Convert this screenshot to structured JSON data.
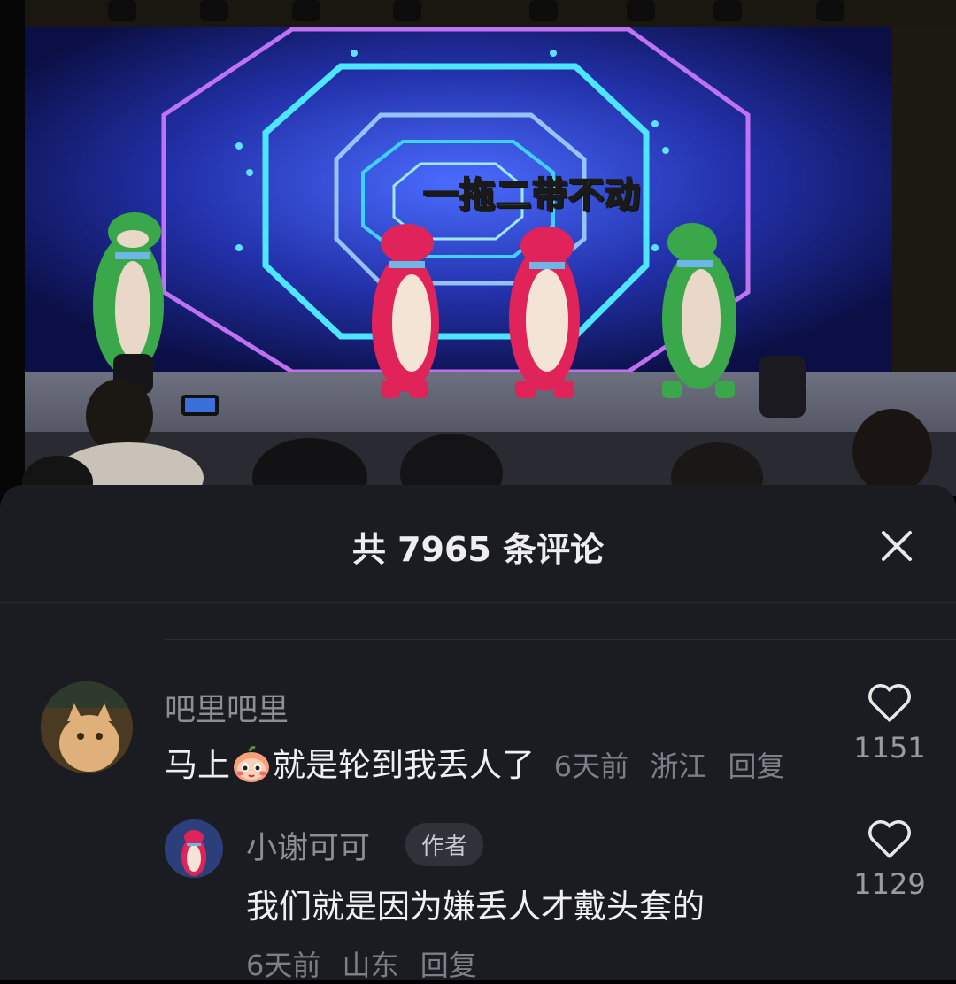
{
  "video": {
    "caption": "一拖二带不动"
  },
  "sheet": {
    "title": "共 7965 条评论",
    "close_icon": "close-icon"
  },
  "comments": [
    {
      "username": "吧里吧里",
      "text_before": "马上",
      "emoji": "blushing-face-emoji",
      "text_after": "就是轮到我丢人了",
      "time": "6天前",
      "location": "浙江",
      "reply_label": "回复",
      "likes": "1151"
    },
    {
      "username": "小谢可可",
      "badge": "作者",
      "text": "我们就是因为嫌丢人才戴头套的",
      "time": "6天前",
      "location": "山东",
      "reply_label": "回复",
      "likes": "1129"
    }
  ]
}
